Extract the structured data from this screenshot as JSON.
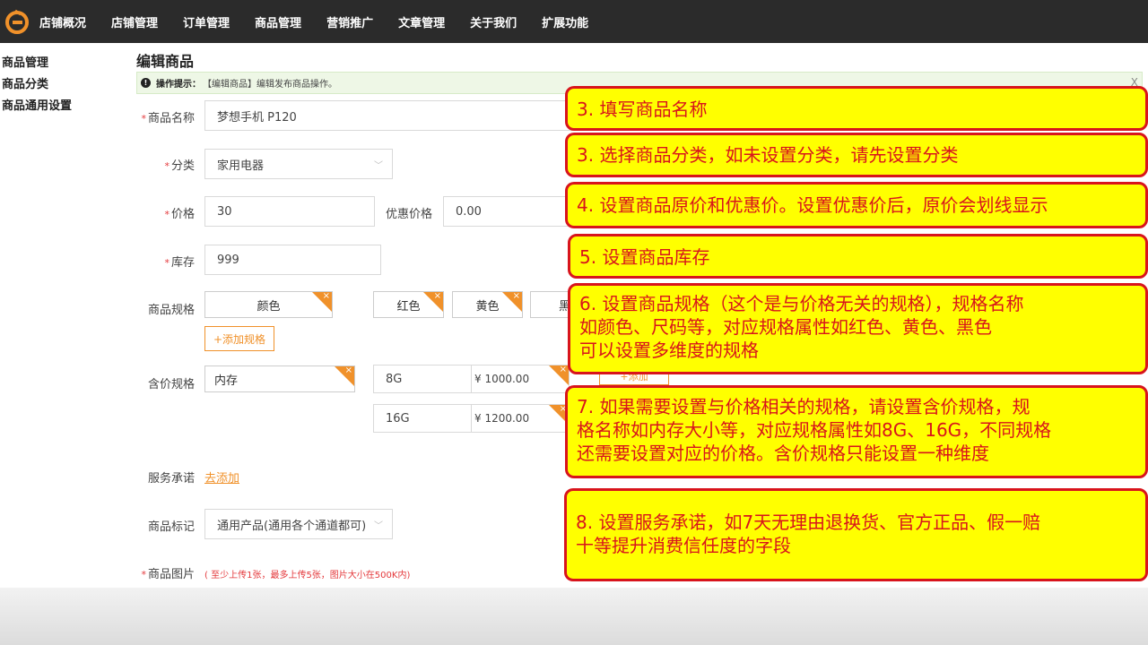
{
  "nav": {
    "items": [
      "店铺概况",
      "店铺管理",
      "订单管理",
      "商品管理",
      "营销推广",
      "文章管理",
      "关于我们",
      "扩展功能"
    ]
  },
  "sidebar": {
    "items": [
      "商品管理",
      "商品分类",
      "商品通用设置"
    ]
  },
  "page": {
    "title": "编辑商品",
    "tip_label": "操作提示：",
    "tip_text": "【编辑商品】编辑发布商品操作。",
    "tip_close": "X"
  },
  "form": {
    "name_label": "商品名称",
    "name_value": "梦想手机 P120",
    "category_label": "分类",
    "category_value": "家用电器",
    "price_label": "价格",
    "price_value": "30",
    "discount_label": "优惠价格",
    "discount_value": "0.00",
    "stock_label": "库存",
    "stock_value": "999",
    "spec_label": "商品规格",
    "spec_name": "颜色",
    "spec_values": [
      "红色",
      "黄色",
      "黑"
    ],
    "add_spec_label": "+添加规格",
    "price_spec_label": "含价规格",
    "price_spec_name": "内存",
    "price_spec_rows": [
      {
        "value": "8G",
        "price": "¥ 1000.00"
      },
      {
        "value": "16G",
        "price": "¥ 1200.00"
      }
    ],
    "add_price_spec_label": "+添加",
    "service_label": "服务承诺",
    "service_link": "去添加",
    "mark_label": "商品标记",
    "mark_value": "通用产品(通用各个通道都可)",
    "image_label": "商品图片",
    "image_hint": "( 至少上传1张，最多上传5张，图片大小在500K内)"
  },
  "callouts": [
    "3. 填写商品名称",
    "3. 选择商品分类，如未设置分类，请先设置分类",
    "4. 设置商品原价和优惠价。设置优惠价后，原价会划线显示",
    "5. 设置商品库存",
    "6. 设置商品规格（这个是与价格无关的规格），规格名称",
    "如颜色、尺码等，对应规格属性如红色、黄色、黑色",
    "可以设置多维度的规格",
    "7. 如果需要设置与价格相关的规格，请设置含价规格，规",
    "格名称如内存大小等，对应规格属性如8G、16G，不同规格",
    "还需要设置对应的价格。含价规格只能设置一种维度",
    "8. 设置服务承诺，如7天无理由退换货、官方正品、假一赔",
    "十等提升消费信任度的字段"
  ],
  "colors": {
    "topbar": "#2b2b2b",
    "accent": "#f0912a",
    "callout_bg": "#ffff00",
    "callout_border": "#d8141c",
    "required": "#e4393c"
  },
  "icons": {
    "logo": "brand-logo-icon",
    "tip": "info-icon",
    "close": "close-icon",
    "tag_remove": "remove-tag-icon",
    "select": "chevron-down-icon"
  }
}
